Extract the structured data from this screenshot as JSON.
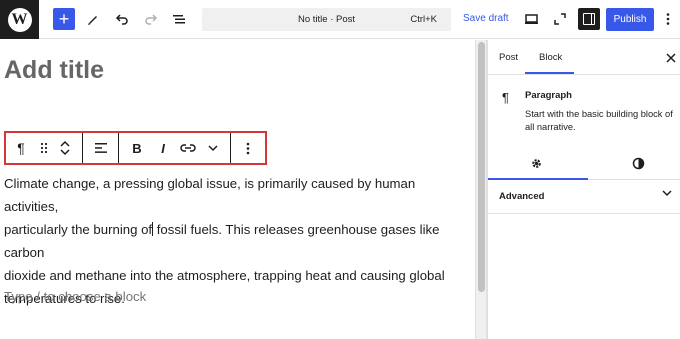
{
  "toolbar": {
    "add_label": "+",
    "doc_title": "No title · Post",
    "shortcut": "Ctrl+K",
    "save_draft": "Save draft",
    "publish": "Publish"
  },
  "editor": {
    "title_placeholder": "Add title",
    "paragraph_lines": [
      "Climate change, a pressing global issue, is primarily caused by human activities,",
      "particularly the burning of",
      " fossil fuels. This releases greenhouse gases like carbon",
      "dioxide and methane into the atmosphere, trapping heat and causing global",
      "temperatures to rise."
    ],
    "block_placeholder": "Type / to choose a block"
  },
  "block_toolbar": {
    "paragraph_glyph": "¶",
    "bold": "B",
    "italic": "I"
  },
  "sidebar": {
    "tab_post": "Post",
    "tab_block": "Block",
    "block_name": "Paragraph",
    "block_description": "Start with the basic building block of all narrative.",
    "advanced": "Advanced"
  },
  "colors": {
    "accent": "#3858e9",
    "highlight": "#d63638"
  }
}
